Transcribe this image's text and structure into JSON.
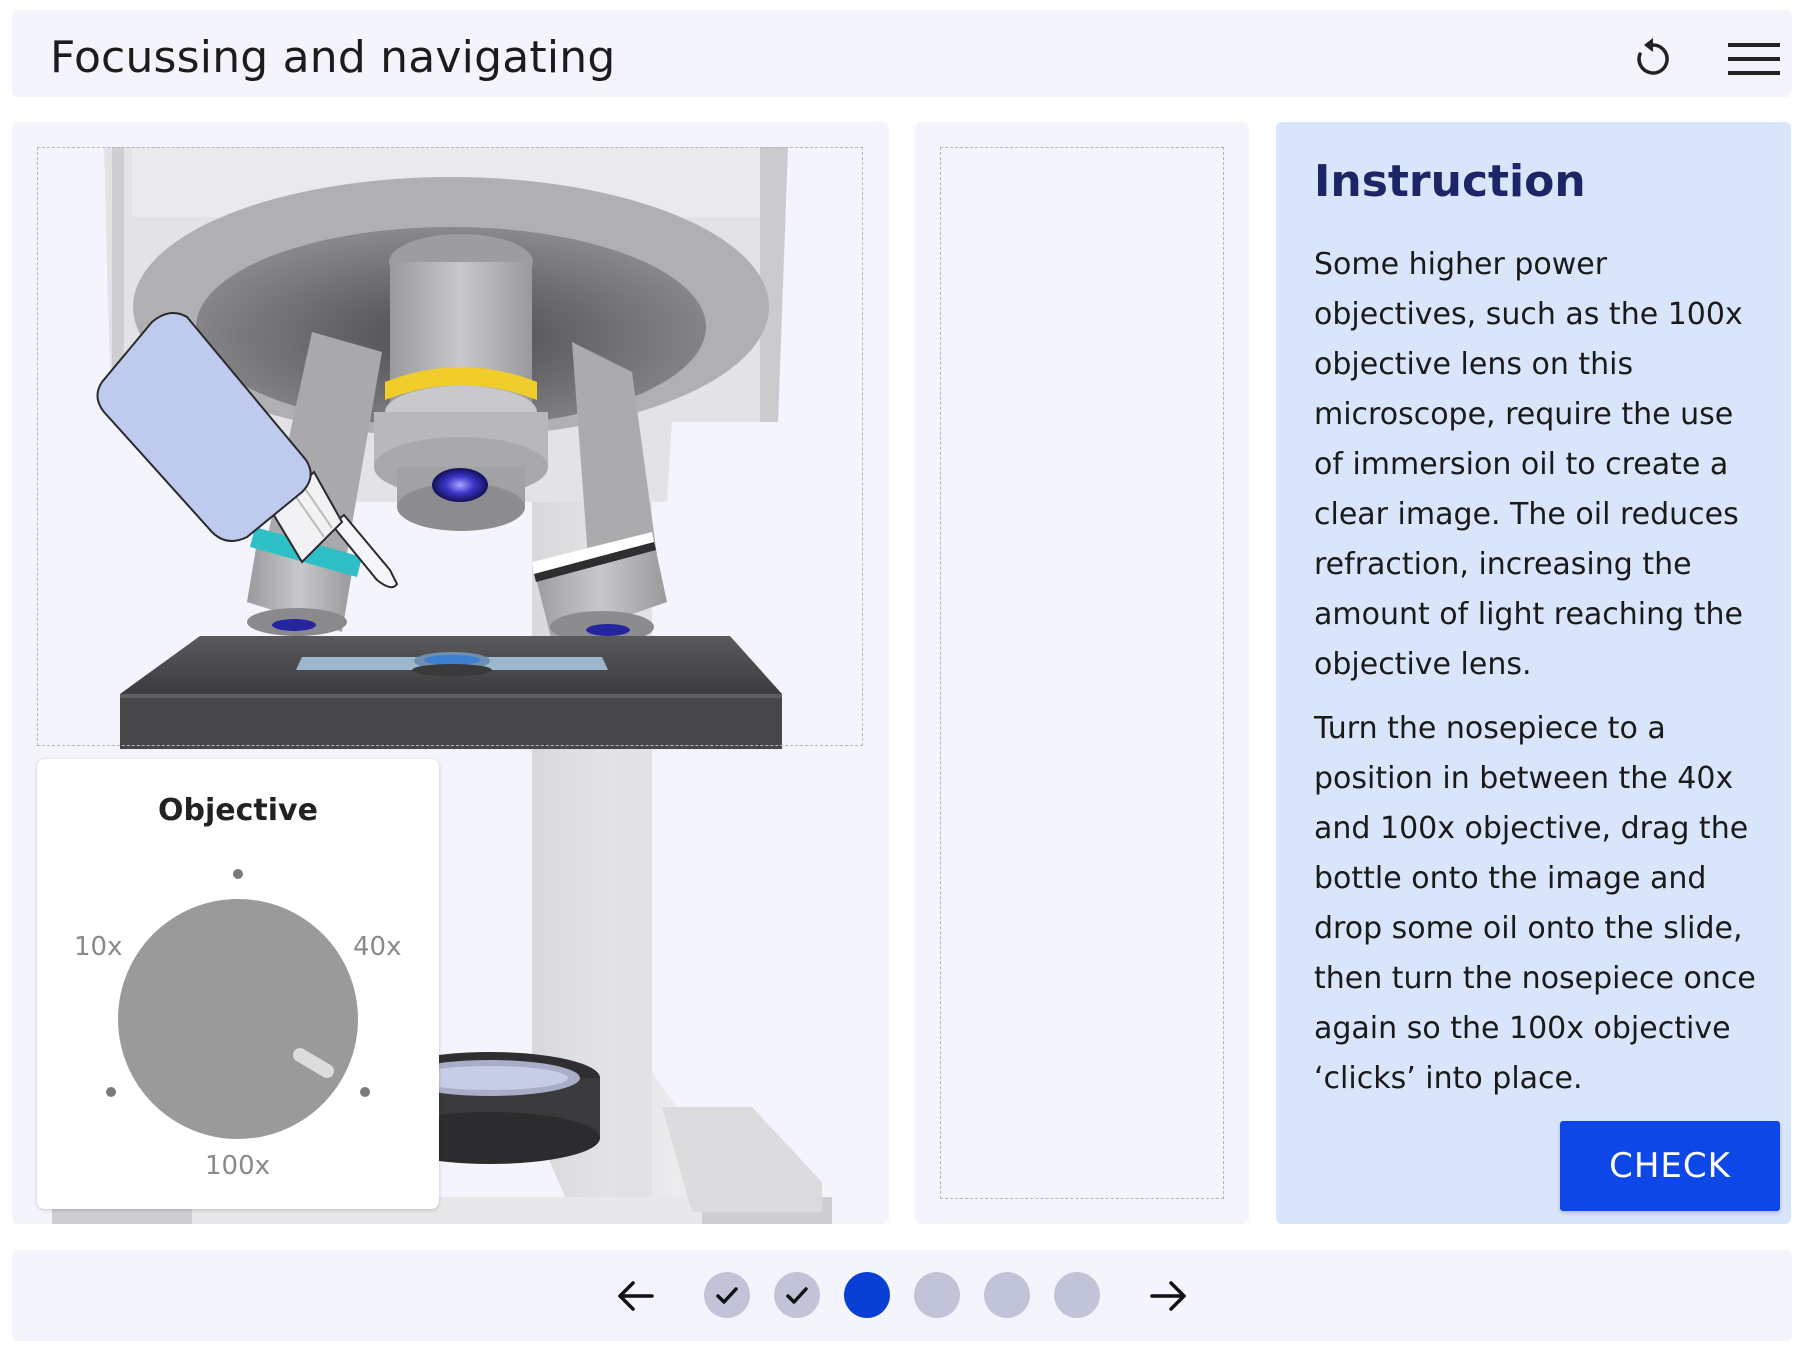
{
  "header": {
    "title": "Focussing and navigating",
    "reset_icon": "reset-icon",
    "menu_icon": "hamburger-menu-icon"
  },
  "objective_control": {
    "title": "Objective",
    "labels": {
      "left": "10x",
      "right": "40x",
      "bottom": "100x"
    }
  },
  "instruction": {
    "title": "Instruction",
    "paragraph_1": "Some higher power objectives, such as the 100x objective lens on this microscope, require the use of immersion oil to create a clear image. The oil reduces refraction, increasing the amount of light reaching the objective lens.",
    "paragraph_2": "Turn the nosepiece to a position in between the 40x and 100x objective, drag the bottle onto the image and drop some oil onto the slide, then turn the nosepiece once again so the 100x objective ‘clicks’ into place.",
    "check_label": "CHECK"
  },
  "navigation": {
    "prev_icon": "arrow-left-icon",
    "next_icon": "arrow-right-icon",
    "steps": [
      {
        "state": "done"
      },
      {
        "state": "done"
      },
      {
        "state": "active"
      },
      {
        "state": "todo"
      },
      {
        "state": "todo"
      },
      {
        "state": "todo"
      }
    ]
  },
  "colors": {
    "accent": "#0d47e8",
    "active_step": "#0a3fd6",
    "panel_bg": "#f4f5fc",
    "instruction_bg": "#d9e5fb",
    "instruction_title": "#1c2565"
  }
}
